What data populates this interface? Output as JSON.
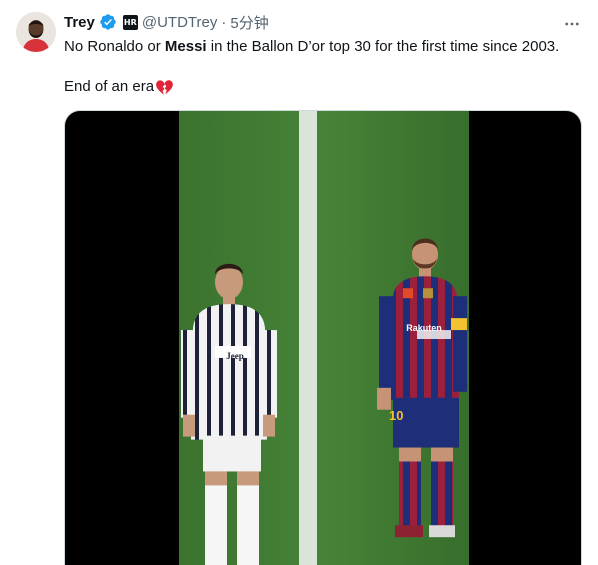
{
  "tweet": {
    "author_name": "Trey",
    "handle": "@UTDTrey",
    "separator": "·",
    "time": "5分钟",
    "org_badge_text": "HR",
    "text_part1": "No Ronaldo or ",
    "text_bold": "Messi",
    "text_part2": " in the Ballon D’or top 30 for the first time since 2003.",
    "text_line2": "End of an era",
    "emoji": "broken-heart-icon",
    "colors": {
      "verified_blue": "#1d9bf0",
      "muted_text": "#536471",
      "broken_heart_red": "#e0243a"
    }
  },
  "media": {
    "kit_number": "10",
    "badge_text_left": "Jeep",
    "badge_text_right": "Rakuten"
  }
}
